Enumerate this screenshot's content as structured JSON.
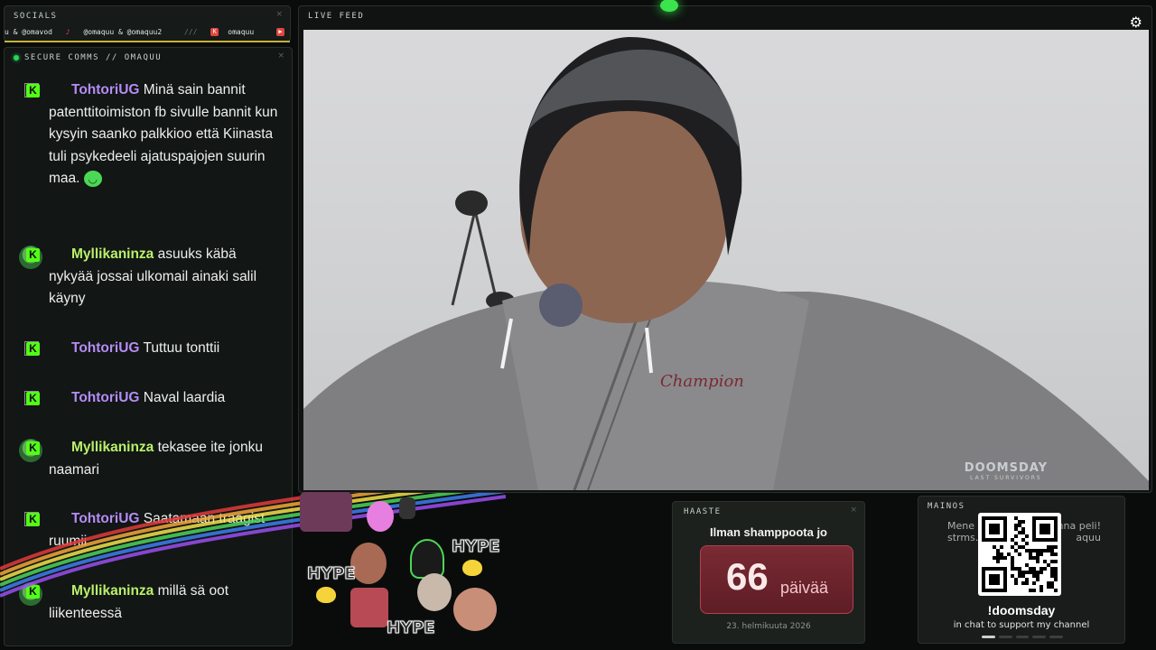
{
  "socials": {
    "title": "SOCIALS",
    "items": [
      {
        "label": "u & @omavod"
      },
      {
        "label": "@omaquu & @omaquu2"
      },
      {
        "label": "///"
      },
      {
        "label": "omaquu"
      },
      {
        "label": "omaquu"
      }
    ]
  },
  "chat": {
    "title": "SECURE COMMS // OMAQUU",
    "messages": [
      {
        "user": "TohtoriUG",
        "color": "#b58cf5",
        "text": "Minä sain bannit patenttitoimiston fb sivulle bannit kun kysyin saanko palkkioo että Kiinasta tuli psykedeeli ajatuspajojen suurin maa."
      },
      {
        "user": "Myllikaninza",
        "color": "#b9f06a",
        "text": "asuuks käbä nykyää jossai ulkomail ainaki salil käyny"
      },
      {
        "user": "TohtoriUG",
        "color": "#b58cf5",
        "text": "Tuttuu tonttii"
      },
      {
        "user": "TohtoriUG",
        "color": "#b58cf5",
        "text": "Naval laardia"
      },
      {
        "user": "Myllikaninza",
        "color": "#b9f06a",
        "text": "tekasee ite jonku naamari"
      },
      {
        "user": "TohtoriUG",
        "color": "#b58cf5",
        "text": "Saatamaan traagist ruumii"
      },
      {
        "user": "Myllikaninza",
        "color": "#b9f06a",
        "text": "millä sä oot liikenteessä"
      }
    ]
  },
  "feed": {
    "title": "LIVE FEED",
    "watermark_main": "DOOMSDAY",
    "watermark_sub": "LAST SURVIVORS"
  },
  "emotes": {
    "hype_label": "HYPE"
  },
  "challenge": {
    "title": "HAASTE",
    "text": "Ilman shamppoota jo",
    "days": "66",
    "unit": "päivää",
    "date": "23. helmikuuta 2026"
  },
  "ad": {
    "title": "MAINOS",
    "left_line1": "Mene",
    "left_line2": "strms.",
    "right_line1": "nna peli!",
    "right_line2": "aquu",
    "command": "!doomsday",
    "subtitle": "in chat to support my channel"
  },
  "colors": {
    "kick_green": "#53fc18",
    "online_green": "#29d65a",
    "challenge_red": "#7a2a33"
  }
}
